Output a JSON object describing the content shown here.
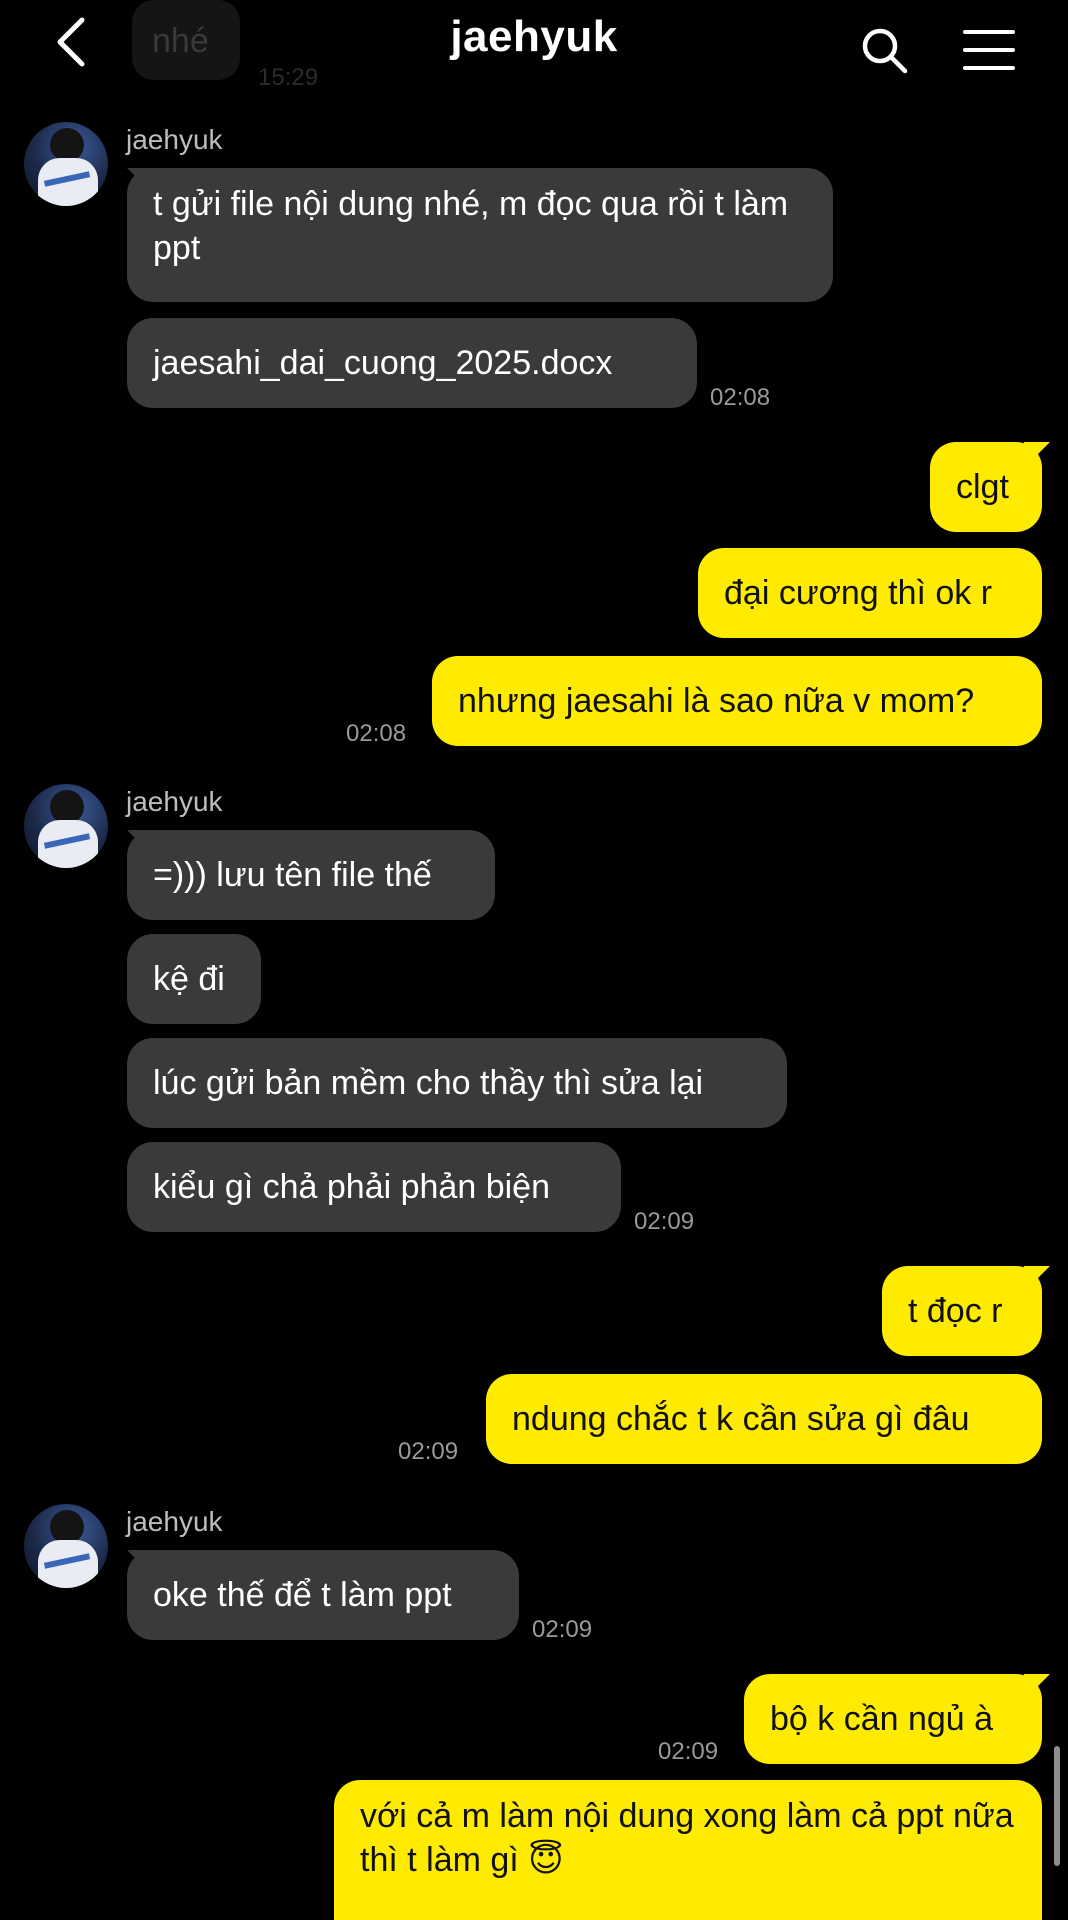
{
  "header": {
    "title": "jaehyuk",
    "back_icon": "chevron-left-icon",
    "search_icon": "search-icon",
    "menu_icon": "hamburger-menu-icon"
  },
  "previous_message": {
    "text": "nhé",
    "time": "15:29"
  },
  "messages": [
    {
      "sender": "jaehyuk",
      "direction": "in",
      "text": "t gửi file nội dung nhé, m đọc qua rồi t làm ppt"
    },
    {
      "direction": "in",
      "text": "jaesahi_dai_cuong_2025.docx",
      "time": "02:08"
    },
    {
      "direction": "out",
      "text": "clgt"
    },
    {
      "direction": "out",
      "text": "đại cương thì ok r"
    },
    {
      "direction": "out",
      "text": "nhưng jaesahi là sao nữa v mom?",
      "time": "02:08"
    },
    {
      "sender": "jaehyuk",
      "direction": "in",
      "text": "=))) lưu tên file thế"
    },
    {
      "direction": "in",
      "text": "kệ đi"
    },
    {
      "direction": "in",
      "text": "lúc gửi bản mềm cho thầy thì sửa lại"
    },
    {
      "direction": "in",
      "text": "kiểu gì chả phải phản biện",
      "time": "02:09"
    },
    {
      "direction": "out",
      "text": "t đọc r"
    },
    {
      "direction": "out",
      "text": "ndung chắc t k cần sửa gì đâu",
      "time": "02:09"
    },
    {
      "sender": "jaehyuk",
      "direction": "in",
      "text": "oke thế để t làm ppt",
      "time": "02:09"
    },
    {
      "direction": "out",
      "text": "bộ k cần ngủ à",
      "time": "02:09"
    },
    {
      "direction": "out",
      "text": "với cả m làm nội dung xong làm cả ppt nữa thì t làm gì 😇"
    }
  ],
  "colors": {
    "background": "#000000",
    "incoming_bubble": "#3a3a3c",
    "outgoing_bubble": "#ffeb00",
    "timestamp": "#9a9a9a"
  }
}
